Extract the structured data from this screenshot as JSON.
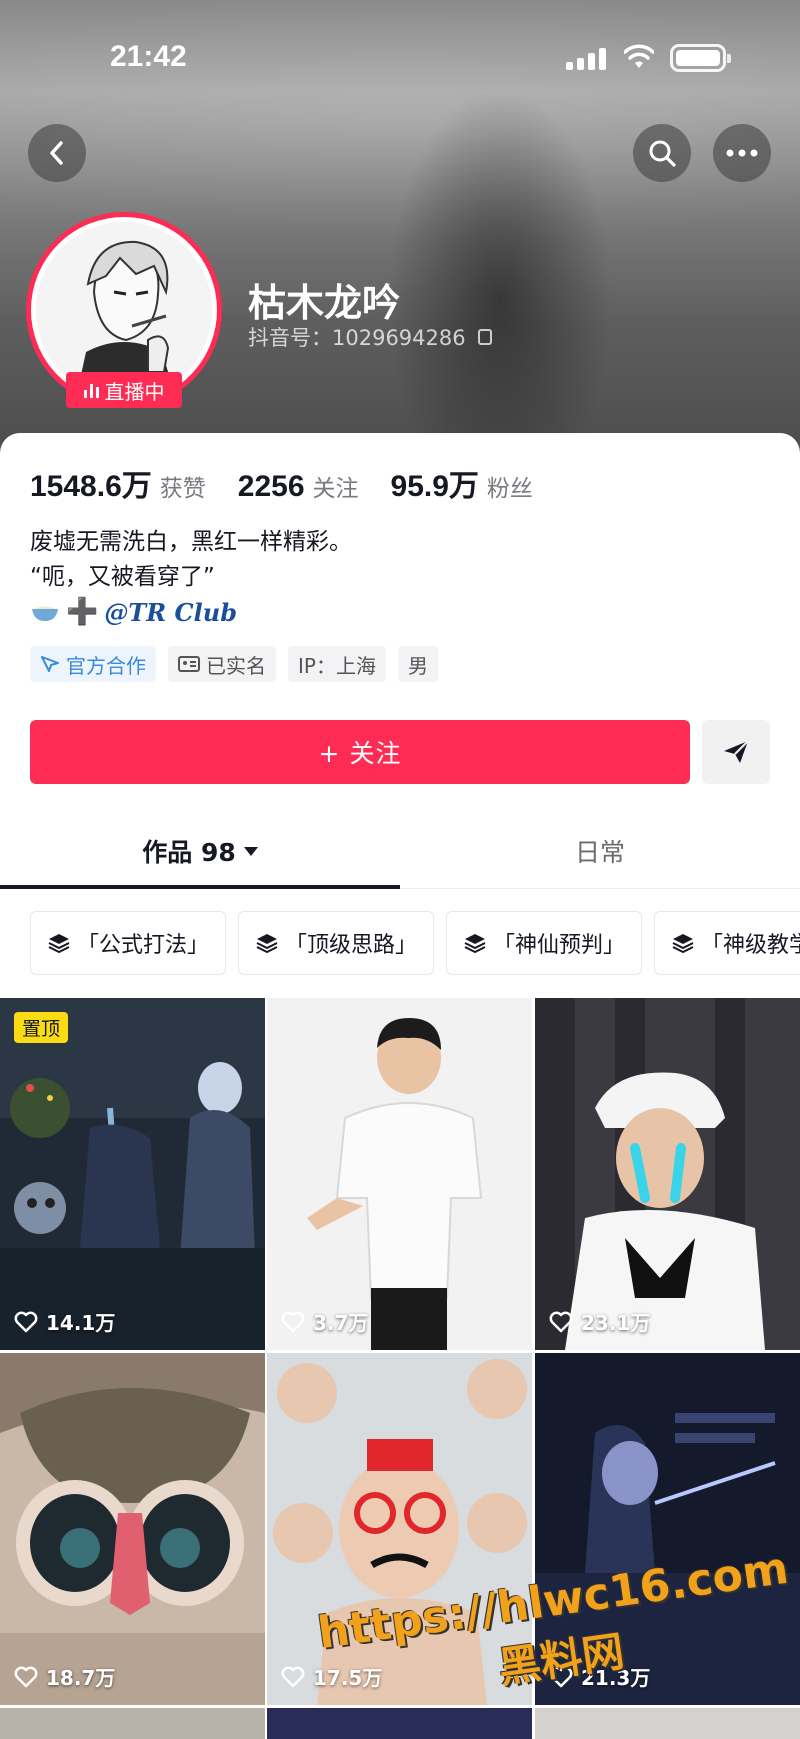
{
  "status_bar": {
    "time": "21:42"
  },
  "profile": {
    "nickname": "枯木龙吟",
    "douyin_id": "抖音号：1029694286",
    "live_badge": "直播中"
  },
  "stats": [
    {
      "value": "1548.6万",
      "label": "获赞"
    },
    {
      "value": "2256",
      "label": "关注"
    },
    {
      "value": "95.9万",
      "label": "粉丝"
    }
  ],
  "bio": {
    "line1": "废墟无需洗白，黑红一样精彩。",
    "line2": "“呃，又被看穿了”",
    "mention": "@TR Club"
  },
  "tags": [
    {
      "label": "官方合作",
      "icon": "official-icon"
    },
    {
      "label": "已实名",
      "icon": "id-card-icon"
    },
    {
      "label": "IP：上海"
    },
    {
      "label": "男"
    }
  ],
  "actions": {
    "follow_label": "+ 关注",
    "share_icon": "send-icon"
  },
  "tabs": {
    "works": "作品 98",
    "daily": "日常"
  },
  "collections": [
    "「公式打法」",
    "「顶级思路」",
    "「神仙预判」",
    "「神级教学」"
  ],
  "videos": [
    {
      "likes": "14.1万",
      "pinned": "置顶"
    },
    {
      "likes": "3.7万"
    },
    {
      "likes": "23.1万"
    },
    {
      "likes": "18.7万"
    },
    {
      "likes": "17.5万"
    },
    {
      "likes": "21.3万"
    }
  ],
  "watermark": {
    "url": "https://hlwc16.com",
    "name": "黑料网"
  },
  "colors": {
    "accent": "#fe2c55",
    "text": "#161823",
    "secondary": "#7a7a80",
    "official": "#3a8bd9"
  }
}
